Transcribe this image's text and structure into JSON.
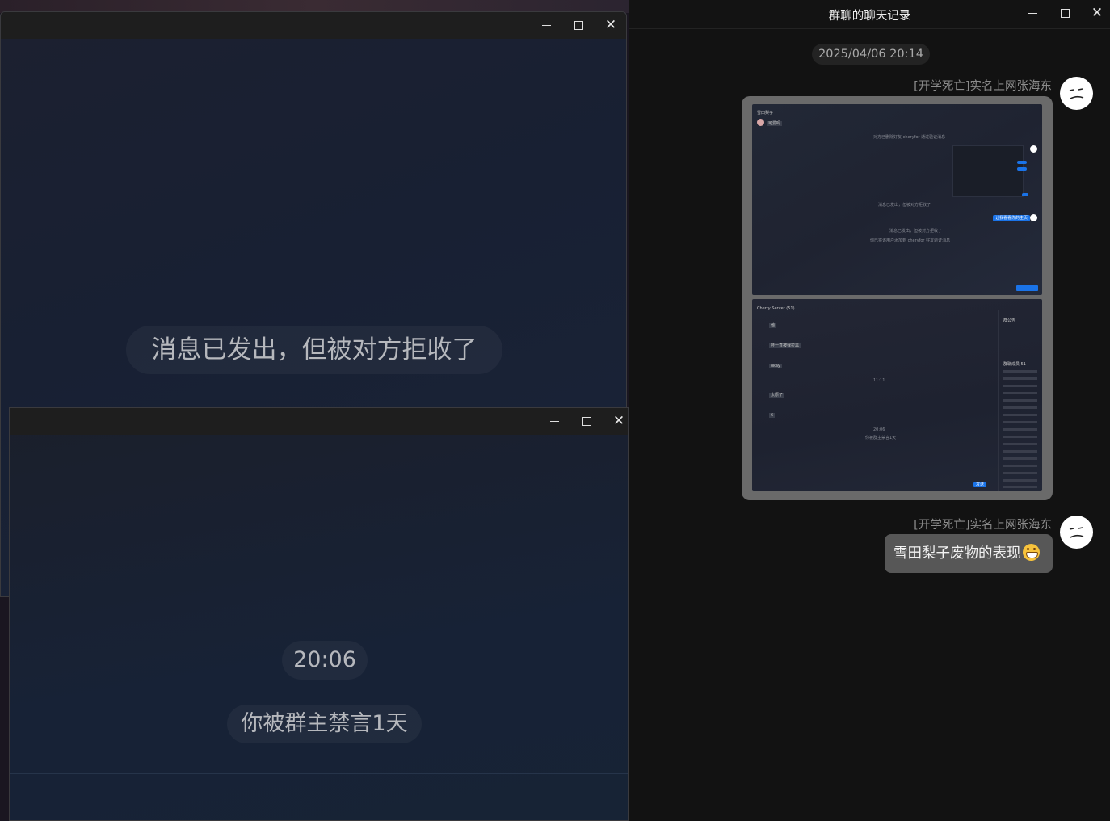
{
  "window_a": {
    "notice": "消息已发出，但被对方拒收了"
  },
  "window_b": {
    "time": "20:06",
    "notice": "你被群主禁言1天"
  },
  "history_window": {
    "title": "群聊的聊天记录",
    "timestamp": "2025/04/06 20:14",
    "messages": [
      {
        "sender": "[开学死亡]实名上网张海东",
        "type": "image"
      },
      {
        "sender": "[开学死亡]实名上网张海东",
        "type": "text",
        "text": "雪田梨子废物的表现",
        "emoji": "grinning-face-icon"
      }
    ]
  },
  "screenshot_thumbs": {
    "top_chat_title": "雪田梨子",
    "top_first_msg": "可爱吗",
    "top_notice_1": "对方已删除好友 cheryfor 通过验证消息",
    "top_outgoing": "让我看看你的主页",
    "top_notice_2": "消息已发出，但被对方拒收了",
    "top_notice_3": "消息已发出，但被对方拒收了",
    "top_notice_4": "你已将该用户添加到 cheryfor 好友验证消息",
    "bottom_server_title": "Cherry Server (51)",
    "bottom_sidebar_heading": "群公告",
    "bottom_members_heading": "群聊成员 51",
    "bottom_msg_1": "他",
    "bottom_msg_2": "哇一直被我拉黑",
    "bottom_msg_3": "okay",
    "bottom_msg_4": "太原了",
    "bottom_msg_5": "6",
    "bottom_time_1": "11:11",
    "bottom_time_2": "20:06",
    "bottom_notice": "你被群主禁言1天",
    "bottom_send": "发送"
  },
  "colors": {
    "accent_blue": "#1a73e8",
    "avatar_bg": "#ffffff",
    "bubble_bg": "#575757"
  }
}
